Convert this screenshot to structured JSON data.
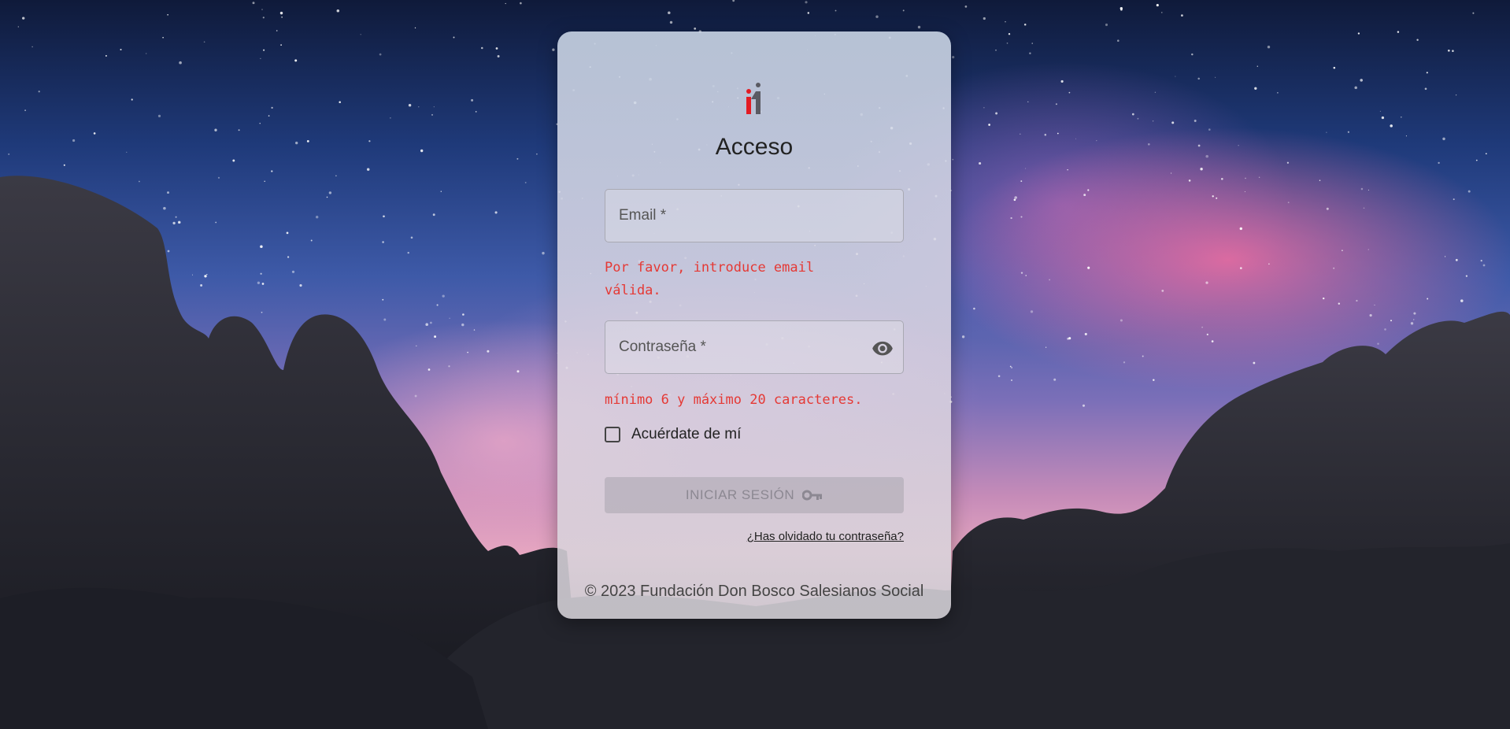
{
  "login": {
    "title": "Acceso",
    "email_label": "Email *",
    "email_value": "",
    "email_error": "Por favor, introduce email válida.",
    "password_label": "Contraseña *",
    "password_value": "",
    "password_error": "mínimo 6 y máximo 20 caracteres.",
    "remember_label": "Acuérdate de mí",
    "remember_checked": false,
    "submit_label": "INICIAR SESIÓN",
    "submit_icon": "key-icon",
    "forgot_link": "¿Has olvidado tu contraseña?",
    "footer": "© 2023 Fundación Don Bosco Salesianos Social"
  },
  "icons": {
    "logo": "brand-logo",
    "password_toggle": "eye-icon"
  },
  "colors": {
    "error": "#e53935",
    "logo_red": "#e31b23",
    "logo_gray": "#5a5a62"
  }
}
